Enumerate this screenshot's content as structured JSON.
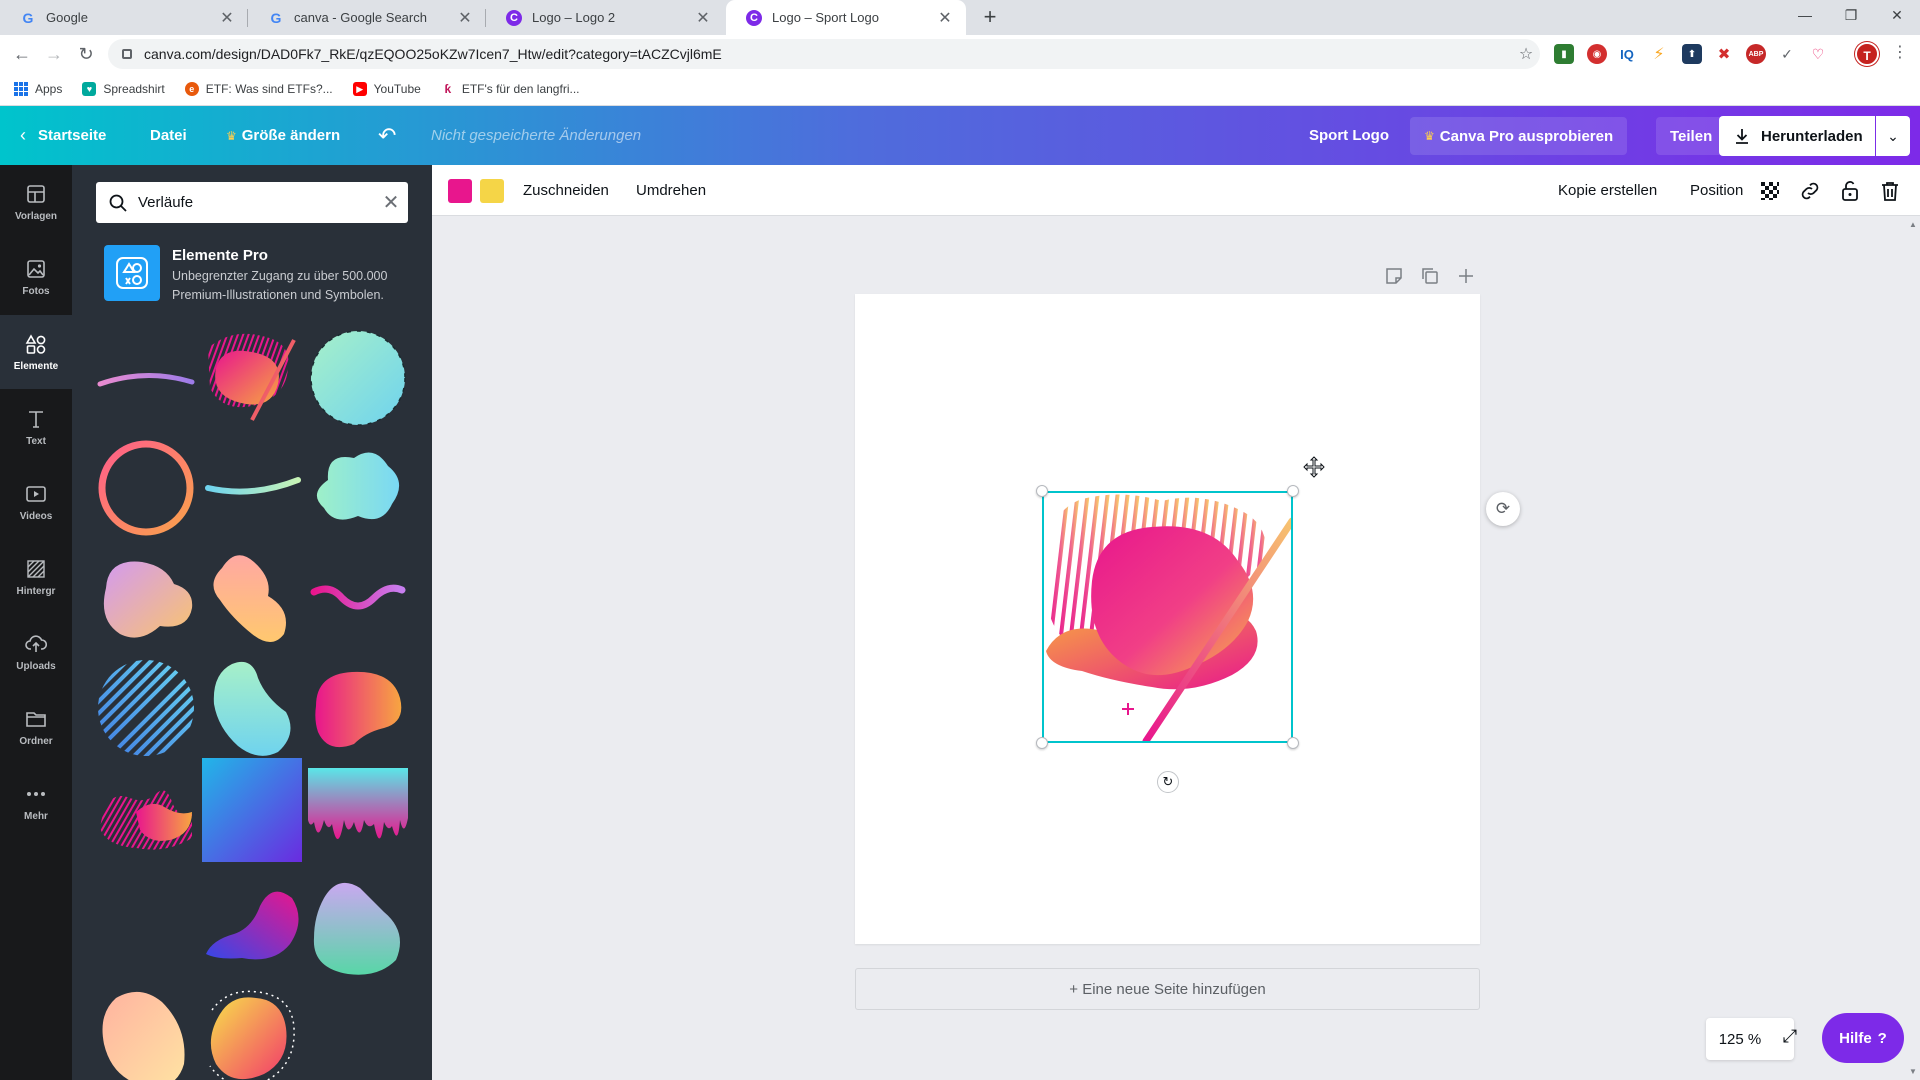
{
  "browser": {
    "tabs": [
      {
        "title": "Google",
        "favicon": "google-icon",
        "active": false
      },
      {
        "title": "canva - Google Search",
        "favicon": "google-icon",
        "active": false
      },
      {
        "title": "Logo – Logo 2",
        "favicon": "canva-icon",
        "active": false
      },
      {
        "title": "Logo – Sport Logo",
        "favicon": "canva-icon",
        "active": true
      }
    ],
    "url": "canva.com/design/DAD0Fk7_RkE/qzEQOO25oKZw7Icen7_Htw/edit?category=tACZCvjl6mE",
    "avatar_letter": "T",
    "bookmarks": [
      {
        "label": "Apps",
        "icon": "apps-grid-icon"
      },
      {
        "label": "Spreadshirt",
        "icon": "spreadshirt-icon"
      },
      {
        "label": "ETF: Was sind ETFs?...",
        "icon": "etf-icon"
      },
      {
        "label": "YouTube",
        "icon": "youtube-icon"
      },
      {
        "label": "ETF's für den langfri...",
        "icon": "etf-brand-icon"
      }
    ]
  },
  "header": {
    "home": "Startseite",
    "file": "Datei",
    "resize": "Größe ändern",
    "unsaved": "Nicht gespeicherte Änderungen",
    "design_name": "Sport Logo",
    "pro_trial": "Canva Pro ausprobieren",
    "share": "Teilen",
    "download": "Herunterladen"
  },
  "rail": [
    {
      "label": "Vorlagen",
      "icon": "templates-icon",
      "active": false
    },
    {
      "label": "Fotos",
      "icon": "photos-icon",
      "active": false
    },
    {
      "label": "Elemente",
      "icon": "elements-icon",
      "active": true
    },
    {
      "label": "Text",
      "icon": "text-icon",
      "active": false
    },
    {
      "label": "Videos",
      "icon": "videos-icon",
      "active": false
    },
    {
      "label": "Hintergr",
      "icon": "background-icon",
      "active": false
    },
    {
      "label": "Uploads",
      "icon": "uploads-icon",
      "active": false
    },
    {
      "label": "Ordner",
      "icon": "folder-icon",
      "active": false
    },
    {
      "label": "Mehr",
      "icon": "more-icon",
      "active": false
    }
  ],
  "panel": {
    "search_value": "Verläufe",
    "promo_title": "Elemente Pro",
    "promo_text_1": "Unbegrenzter Zugang zu über 500.000",
    "promo_text_2": "Premium-Illustrationen und Symbolen."
  },
  "editor_toolbar": {
    "colors": [
      "#e8168d",
      "#f5d547"
    ],
    "crop": "Zuschneiden",
    "flip": "Umdrehen",
    "duplicate": "Kopie erstellen",
    "position": "Position"
  },
  "canvas": {
    "add_page": "+ Eine neue Seite hinzufügen"
  },
  "footer": {
    "zoom": "125 %",
    "help": "Hilfe"
  },
  "colors": {
    "accent": "#00c4cc",
    "brand_purple": "#7d2ae8",
    "pink": "#e8168d",
    "orange": "#f7a541"
  }
}
